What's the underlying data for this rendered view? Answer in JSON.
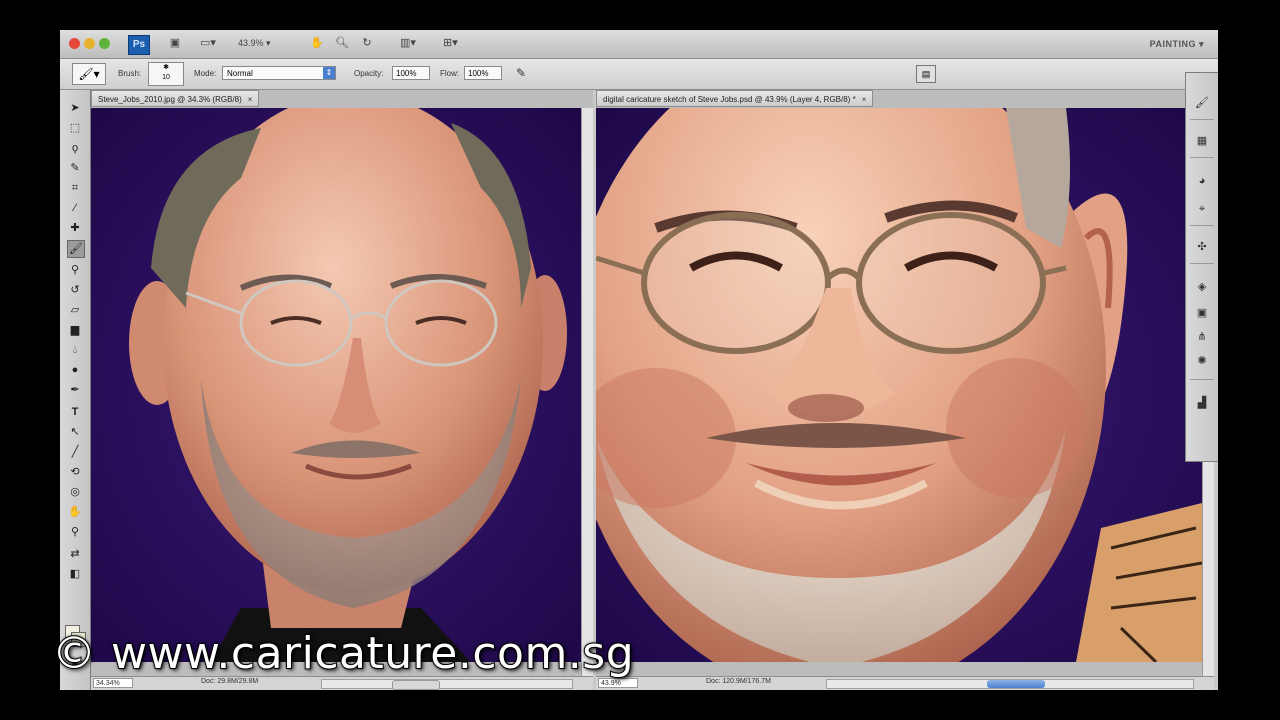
{
  "app": {
    "logo": "Ps",
    "zoom_control": "43.9% ▾",
    "workspace": "PAINTING ▾"
  },
  "options_bar": {
    "brush_label": "Brush:",
    "brush_size": "10",
    "mode_label": "Mode:",
    "mode_value": "Normal",
    "opacity_label": "Opacity:",
    "opacity_value": "100%",
    "flow_label": "Flow:",
    "flow_value": "100%"
  },
  "documents": [
    {
      "tab_title": "Steve_Jobs_2010.jpg @ 34.3% (RGB/8)",
      "zoom": "34.34%",
      "status": "Doc: 29.8M/29.8M"
    },
    {
      "tab_title": "digital caricature sketch of Steve Jobs.psd @ 43.9% (Layer 4, RGB/8) *",
      "zoom": "43.9%",
      "status": "Doc: 120.9M/176.7M"
    }
  ],
  "watermark": "© www.caricature.com.sg",
  "colors": {
    "background_purple": "#2a0e5e",
    "skin": "#e0a184",
    "accent_blue": "#4a7fd0"
  }
}
